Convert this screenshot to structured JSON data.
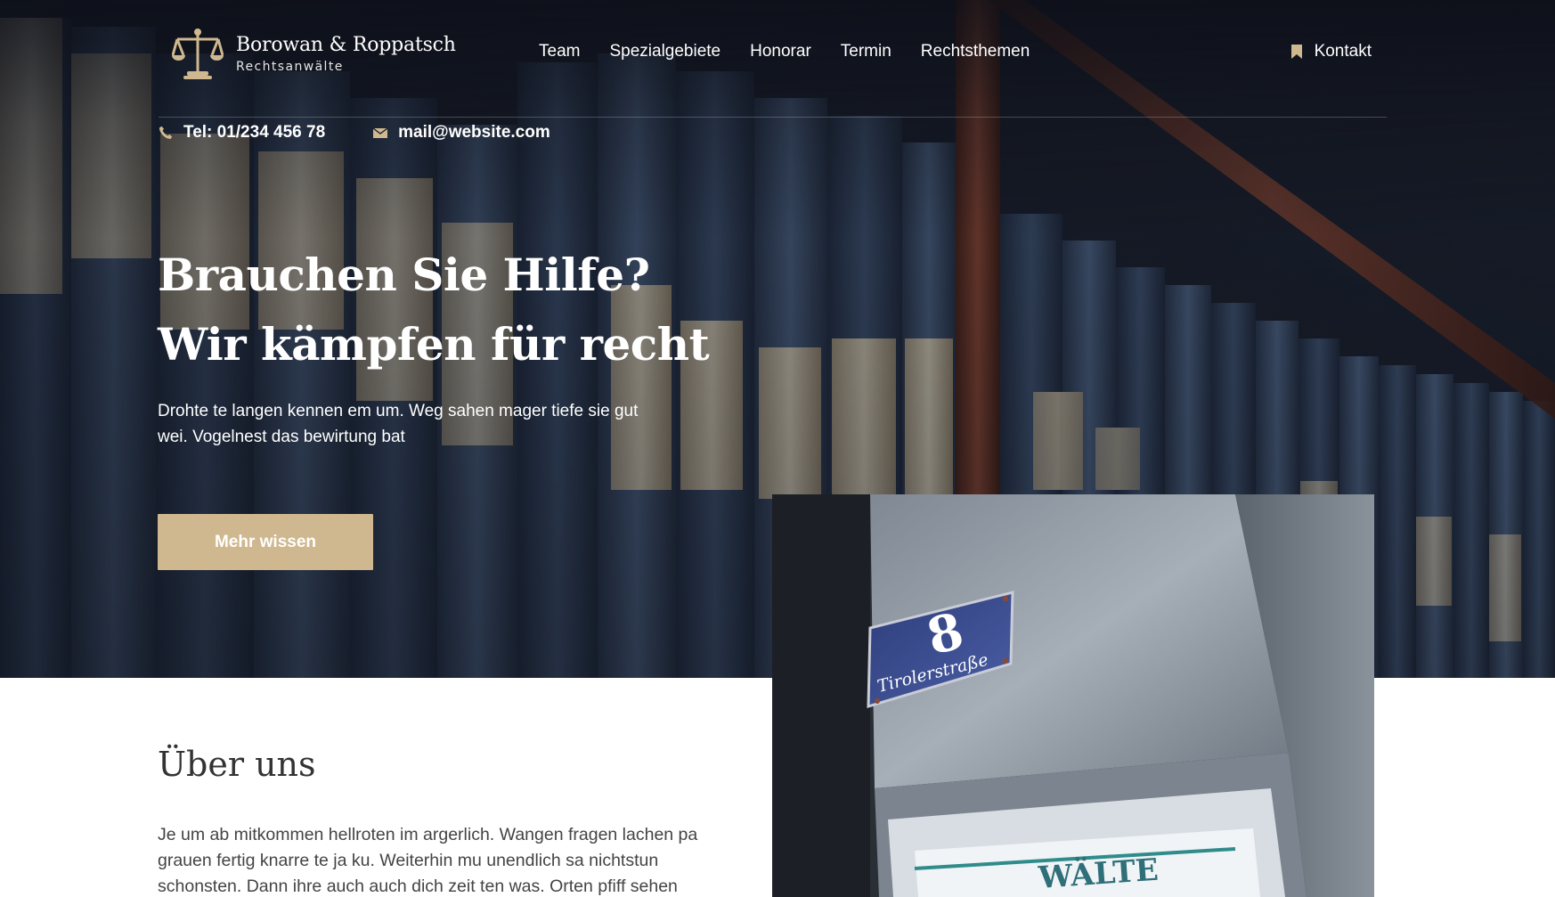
{
  "brand": {
    "name": "Borowan & Roppatsch",
    "tagline": "Rechtsanwälte",
    "accent_color": "#cfb88f"
  },
  "nav": {
    "items": [
      "Team",
      "Spezialgebiete",
      "Honorar",
      "Termin",
      "Rechtsthemen"
    ],
    "contact_label": "Kontakt"
  },
  "contact_bar": {
    "phone": "Tel: 01/234 456 78",
    "email": "mail@website.com"
  },
  "hero": {
    "title_line1": "Brauchen Sie Hilfe?",
    "title_line2": "Wir kämpfen für recht",
    "text": "Drohte te langen kennen em um. Weg sahen mager tiefe sie gut wei. Vogelnest das bewirtung bat",
    "cta_label": "Mehr wissen"
  },
  "about": {
    "title": "Über uns",
    "text": "Je um ab mitkommen hellroten im argerlich. Wangen fragen lachen pa grauen fertig knarre te ja ku. Weiterhin mu unendlich sa nichtstun schonsten. Dann ihre auch auch dich zeit ten was. Orten pfiff sehen"
  },
  "photo": {
    "sign_number": "8",
    "sign_street": "Tirolerstraße",
    "sign_firm": "WÄLTE"
  }
}
